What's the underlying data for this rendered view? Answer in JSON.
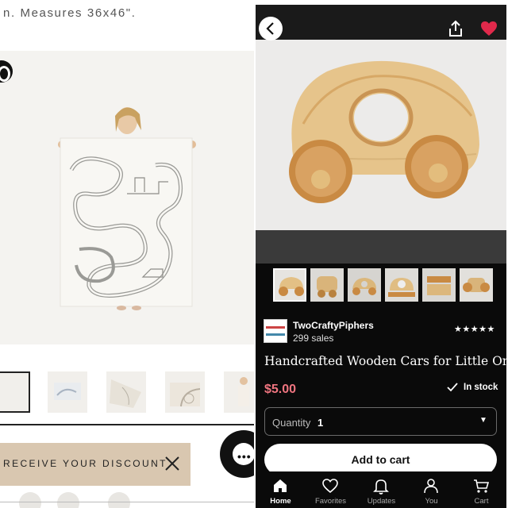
{
  "left": {
    "description": "n. Measures 36x46\".",
    "promo_label": "RECEIVE YOUR DISCOUNT"
  },
  "right": {
    "shop": {
      "name": "TwoCraftyPiphers",
      "sales": "299 sales",
      "rating": "★★★★★"
    },
    "product_title": "Handcrafted Wooden Cars for Little On...",
    "price": "$5.00",
    "stock": "In stock",
    "quantity": {
      "label": "Quantity",
      "value": "1"
    },
    "cart_button": "Add to cart",
    "tabs": [
      {
        "label": "Home",
        "icon": "home-icon"
      },
      {
        "label": "Favorites",
        "icon": "heart-outline-icon"
      },
      {
        "label": "Updates",
        "icon": "bell-icon"
      },
      {
        "label": "You",
        "icon": "person-icon"
      },
      {
        "label": "Cart",
        "icon": "cart-icon"
      }
    ]
  },
  "colors": {
    "price": "#f07580",
    "favorite": "#e0294b",
    "promo_bg": "#d9c7b0",
    "app_bg": "#0a0a0a"
  }
}
